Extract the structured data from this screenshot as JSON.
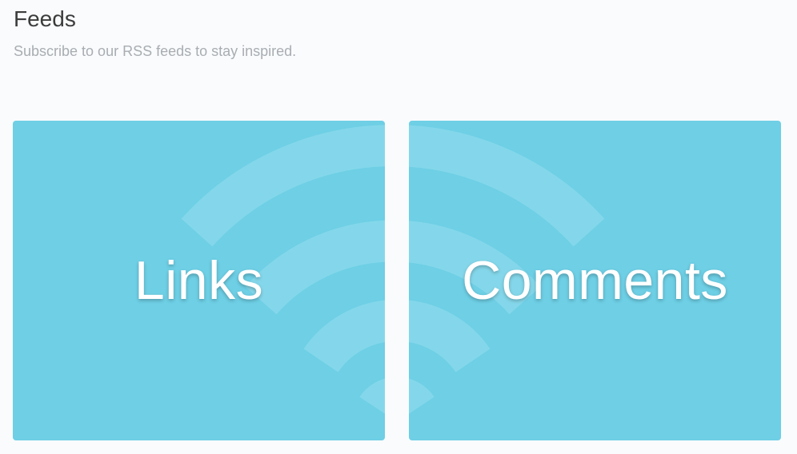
{
  "header": {
    "title": "Feeds",
    "subtitle": "Subscribe to our RSS feeds to stay inspired."
  },
  "feeds": [
    {
      "label": "Links",
      "icon": "rss-icon"
    },
    {
      "label": "Comments",
      "icon": "rss-icon"
    }
  ],
  "colors": {
    "background": "#f9fbfd",
    "tile": "#6ecfe5",
    "tile_icon": "#84d7ea",
    "title": "#3c3c3c",
    "subtitle": "#a9adb1"
  }
}
